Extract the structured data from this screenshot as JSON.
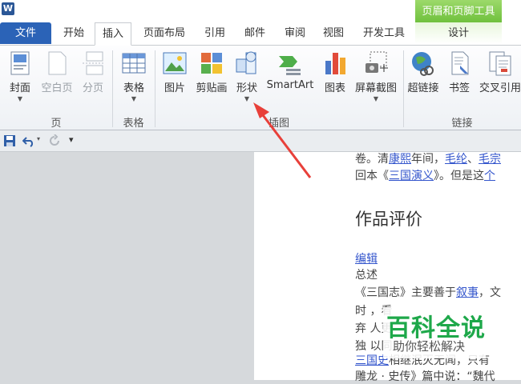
{
  "app": {
    "icon_letter": "W"
  },
  "context_tab": {
    "header": "页眉和页脚工具",
    "tab": "设计"
  },
  "tabs": [
    "文件",
    "开始",
    "插入",
    "页面布局",
    "引用",
    "邮件",
    "审阅",
    "视图",
    "开发工具"
  ],
  "ribbon": {
    "groups": {
      "page": "页",
      "table": "表格",
      "illustrations": "插图",
      "links": "链接"
    },
    "buttons": {
      "cover": "封面",
      "blank_page": "空白页",
      "page_break": "分页",
      "table": "表格",
      "picture": "图片",
      "clip_art": "剪贴画",
      "shapes": "形状",
      "smartart": "SmartArt",
      "chart": "图表",
      "screenshot": "屏幕截图",
      "hyperlink": "超链接",
      "bookmark": "书签",
      "cross_reference": "交叉引用"
    }
  },
  "document": {
    "line1": {
      "pre": "卷。清",
      "link1": "康熙",
      "mid1": "年间，",
      "link2": "毛纶",
      "mid2": "、",
      "link3": "毛宗"
    },
    "line2": {
      "pre": "回本《",
      "link": "三国演义",
      "mid": "》。但是这",
      "tail": "个"
    },
    "heading": "作品评价",
    "edit_link": "编辑",
    "summary": "总述",
    "p1": {
      "pre": "《三国志》主要善于",
      "link": "叙事",
      "post": "，文"
    },
    "p2": "时                        ，看",
    "p3": "弃                        人更",
    "p4": "独                        以同",
    "p5": {
      "link": "三国史",
      "post": "相继泯灭无闻，只有"
    },
    "p6": "雕龙 · 史传》篇中说：“魏代"
  },
  "watermark": {
    "title": "百科全说",
    "subtitle": "助你轻松解决"
  }
}
